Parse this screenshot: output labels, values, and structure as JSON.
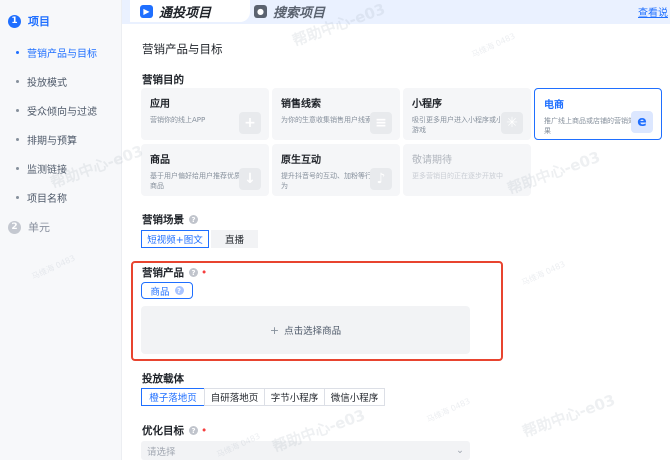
{
  "sidebar": {
    "steps": [
      {
        "num": "1",
        "label": "项目"
      },
      {
        "num": "2",
        "label": "单元"
      }
    ],
    "items": [
      {
        "label": "营销产品与目标"
      },
      {
        "label": "投放模式"
      },
      {
        "label": "受众倾向与过滤"
      },
      {
        "label": "排期与预算"
      },
      {
        "label": "监测链接"
      },
      {
        "label": "项目名称"
      }
    ]
  },
  "tabs": {
    "active": "通投项目",
    "other": "搜索项目",
    "top_link": "查看说"
  },
  "page": {
    "section_title": "营销产品与目标",
    "purpose_label": "营销目的",
    "purposes": [
      {
        "title": "应用",
        "desc": "营销你的线上APP"
      },
      {
        "title": "销售线索",
        "desc": "为你的生意收集销售用户线索"
      },
      {
        "title": "小程序",
        "desc": "吸引更多用户进入小程序或小游戏"
      },
      {
        "title": "电商",
        "desc": "推广线上商品或店铺的营销效果"
      },
      {
        "title": "商品",
        "desc": "基于用户偏好给用户推荐优质商品"
      },
      {
        "title": "原生互动",
        "desc": "提升抖音号的互动、加粉等行为"
      },
      {
        "title": "敬请期待",
        "desc": "更多营销目的正在逐步开放中"
      }
    ],
    "scene_label": "营销场景",
    "scenes": [
      "短视频+图文",
      "直播"
    ],
    "product_label": "营销产品",
    "product_tag": "商品",
    "picker_text": "点击选择商品",
    "carrier_label": "投放载体",
    "carriers": [
      "橙子落地页",
      "自研落地页",
      "字节小程序",
      "微信小程序"
    ],
    "goal_label": "优化目标",
    "goal_placeholder": "请选择"
  },
  "watermark": {
    "big": "帮助中心-e03",
    "small": "马维海 0483"
  },
  "colors": {
    "accent": "#1f6fff",
    "highlight": "#e8442f"
  }
}
